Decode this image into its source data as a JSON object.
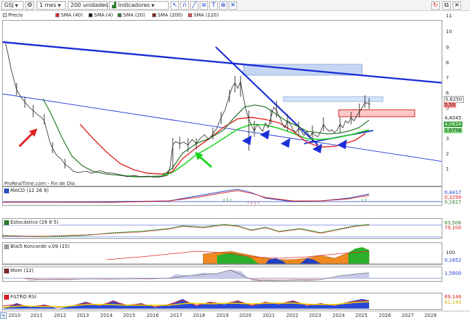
{
  "toolbar": {
    "symbol": "GSJ",
    "timeframe": "1 mes",
    "units": "200 unidades",
    "indicators_label": "Indicadores"
  },
  "legend": [
    {
      "label": "Precio",
      "color": "#8a8a8a"
    },
    {
      "label": "SMA (40)",
      "color": "#e02020"
    },
    {
      "label": "SMA (4)",
      "color": "#111111"
    },
    {
      "label": "SMA (20)",
      "color": "#2d7a2d"
    },
    {
      "label": "SMA (200)",
      "color": "#8b1c1c"
    },
    {
      "label": "SMA (120)",
      "color": "#e05050"
    }
  ],
  "source_label": "ProRealTime.com - Fin de Día",
  "price_axis": {
    "ticks": [
      "11",
      "10",
      "9",
      "8",
      "7",
      "6",
      "5",
      "4",
      "3",
      "2",
      "1"
    ],
    "tags": [
      {
        "text": "5,6250",
        "color": "#000000",
        "bg": "#ffffff"
      },
      {
        "text": "5,50",
        "color": "#000000",
        "bg": "#ff8a8a"
      },
      {
        "text": "4,4045",
        "color": "#000000",
        "bg": "#ffffff"
      },
      {
        "text": "4,0624",
        "color": "#ffffff",
        "bg": "#35a035"
      },
      {
        "text": "3,6756",
        "color": "#000000",
        "bg": "#7fe07f"
      }
    ]
  },
  "panels": {
    "macd": {
      "title": "MACD (12 26 9)",
      "tags": [
        {
          "text": "0,4417",
          "color": "#1a3fd0"
        },
        {
          "text": "0,3299",
          "color": "#e02020"
        },
        {
          "text": "0,1627",
          "color": "#2d7a2d"
        }
      ]
    },
    "stoch": {
      "title": "Estocástico (26 8 5)",
      "tags": [
        {
          "text": "83,506",
          "color": "#2d7a2d"
        },
        {
          "text": "79,100",
          "color": "#e02020"
        }
      ]
    },
    "blai5": {
      "title": "Blai5 Koncorde v.09 (15)",
      "ticks": [
        "100",
        "0"
      ],
      "tags": [
        {
          "text": "0,1652",
          "color": "#1a3fd0"
        }
      ]
    },
    "mom": {
      "title": "Mom (12)",
      "tags": [
        {
          "text": "1,5600",
          "color": "#1a3fd0"
        }
      ]
    },
    "rsi": {
      "title": "FILTRO RSI",
      "tags": [
        {
          "text": "69,146",
          "color": "#e02020"
        },
        {
          "text": "61,143",
          "color": "#d4b000"
        }
      ]
    }
  },
  "years": [
    "2010",
    "2011",
    "2012",
    "2013",
    "2014",
    "2015",
    "2016",
    "2017",
    "2018",
    "2019",
    "2020",
    "2021",
    "2022",
    "2023",
    "2024",
    "2025",
    "2026",
    "2027",
    "2028"
  ],
  "colors": {
    "trend": "#1a2fd6",
    "sma_red": "#e02020",
    "sma_green": "#1cd21c",
    "sma_dark": "#2d7a2d",
    "box_blue": "#b8ccf0",
    "box_red": "#ffb0b0",
    "price": "#222222"
  }
}
